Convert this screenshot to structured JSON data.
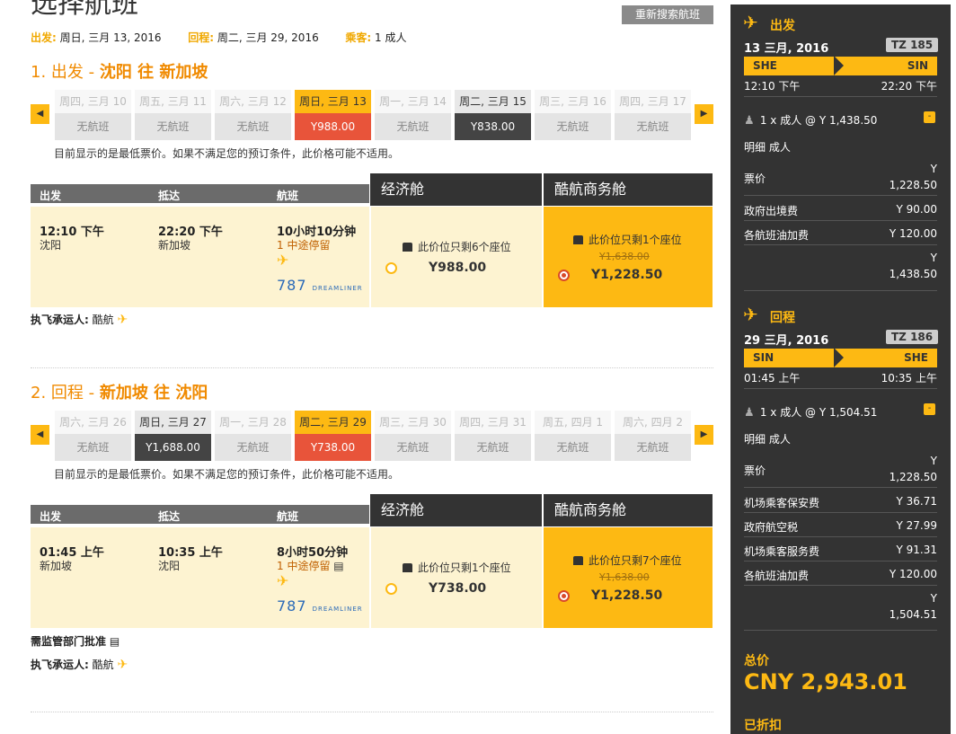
{
  "page": {
    "title": "选择航班",
    "research_button": "重新搜索航班"
  },
  "trip": {
    "depart_label": "出发:",
    "depart_value": "周日, 三月 13, 2016",
    "return_label": "回程:",
    "return_value": "周二, 三月 29, 2016",
    "pax_label": "乘客:",
    "pax_value": "1 成人"
  },
  "outbound": {
    "heading_prefix": "1. 出发 - ",
    "heading_route": "沈阳 往 新加坡",
    "dates": [
      {
        "day": "周四, 三月 10",
        "price": "无航班",
        "state": "none"
      },
      {
        "day": "周五, 三月 11",
        "price": "无航班",
        "state": "none"
      },
      {
        "day": "周六, 三月 12",
        "price": "无航班",
        "state": "none"
      },
      {
        "day": "周日, 三月 13",
        "price": "Y988.00",
        "state": "sel"
      },
      {
        "day": "周一, 三月 14",
        "price": "无航班",
        "state": "none"
      },
      {
        "day": "周二, 三月 15",
        "price": "Y838.00",
        "state": "has"
      },
      {
        "day": "周三, 三月 16",
        "price": "无航班",
        "state": "none"
      },
      {
        "day": "周四, 三月 17",
        "price": "无航班",
        "state": "none"
      }
    ],
    "note": "目前显示的是最低票价。如果不满足您的预订条件，此价格可能不适用。",
    "col_depart": "出发",
    "col_arrive": "抵达",
    "col_flight": "航班",
    "econ_header": "经济舱",
    "biz_header": "酷航商务舱",
    "depart_time": "12:10 下午",
    "depart_city": "沈阳",
    "arrive_time": "22:20 下午",
    "arrive_city": "新加坡",
    "duration": "10小时10分钟",
    "stops": "1 中途停留",
    "econ_seats": "此价位只剩6个座位",
    "econ_price": "Y988.00",
    "biz_seats": "此价位只剩1个座位",
    "biz_old_price": "Y1,638.00",
    "biz_price": "Y1,228.50",
    "carrier_label": "执飞承运人:",
    "carrier": "酷航"
  },
  "inbound": {
    "heading_prefix": "2. 回程 - ",
    "heading_route": "新加坡 往 沈阳",
    "dates": [
      {
        "day": "周六, 三月 26",
        "price": "无航班",
        "state": "none"
      },
      {
        "day": "周日, 三月 27",
        "price": "Y1,688.00",
        "state": "has"
      },
      {
        "day": "周一, 三月 28",
        "price": "无航班",
        "state": "none"
      },
      {
        "day": "周二, 三月 29",
        "price": "Y738.00",
        "state": "sel"
      },
      {
        "day": "周三, 三月 30",
        "price": "无航班",
        "state": "none"
      },
      {
        "day": "周四, 三月 31",
        "price": "无航班",
        "state": "none"
      },
      {
        "day": "周五, 四月 1",
        "price": "无航班",
        "state": "none"
      },
      {
        "day": "周六, 四月 2",
        "price": "无航班",
        "state": "none"
      }
    ],
    "note": "目前显示的是最低票价。如果不满足您的预订条件，此价格可能不适用。",
    "col_depart": "出发",
    "col_arrive": "抵达",
    "col_flight": "航班",
    "econ_header": "经济舱",
    "biz_header": "酷航商务舱",
    "depart_time": "01:45 上午",
    "depart_city": "新加坡",
    "arrive_time": "10:35 上午",
    "arrive_city": "沈阳",
    "duration": "8小时50分钟",
    "stops": "1 中途停留",
    "econ_seats": "此价位只剩1个座位",
    "econ_price": "Y738.00",
    "biz_seats": "此价位只剩7个座位",
    "biz_old_price": "Y1,638.00",
    "biz_price": "Y1,228.50",
    "approval": "需监管部门批准",
    "carrier_label": "执飞承运人:",
    "carrier": "酷航"
  },
  "aircraft": {
    "model": "787",
    "brand": "DREAMLINER"
  },
  "sidebar": {
    "out": {
      "title": "出发",
      "date": "13 三月, 2016",
      "flight_no": "TZ 185",
      "from": "SHE",
      "to": "SIN",
      "dep_time": "12:10 下午",
      "arr_time": "22:20 下午",
      "pax": "1 x 成人 @ Y 1,438.50",
      "detail": "明细 成人",
      "fare_label": "票价",
      "fare_cur": "Y",
      "fare_val": "1,228.50",
      "fees": [
        {
          "label": "政府出境费",
          "value": "Y 90.00"
        },
        {
          "label": "各航班油加费",
          "value": "Y 120.00"
        }
      ],
      "sub_cur": "Y",
      "sub_val": "1,438.50"
    },
    "ret": {
      "title": "回程",
      "date": "29 三月, 2016",
      "flight_no": "TZ 186",
      "from": "SIN",
      "to": "SHE",
      "dep_time": "01:45 上午",
      "arr_time": "10:35 上午",
      "pax": "1 x 成人 @ Y 1,504.51",
      "detail": "明细 成人",
      "fare_label": "票价",
      "fare_cur": "Y",
      "fare_val": "1,228.50",
      "fees": [
        {
          "label": "机场乘客保安费",
          "value": "Y 36.71"
        },
        {
          "label": "政府航空税",
          "value": "Y 27.99"
        },
        {
          "label": "机场乘客服务费",
          "value": "Y 91.31"
        },
        {
          "label": "各航班油加费",
          "value": "Y 120.00"
        }
      ],
      "sub_cur": "Y",
      "sub_val": "1,504.51"
    },
    "total_label": "总价",
    "total": "CNY 2,943.01",
    "discount": "已折扣"
  },
  "colors": {
    "accent": "#fdb913",
    "orange_text": "#f08a00",
    "selected_price": "#e8543a",
    "dark": "#333333"
  }
}
